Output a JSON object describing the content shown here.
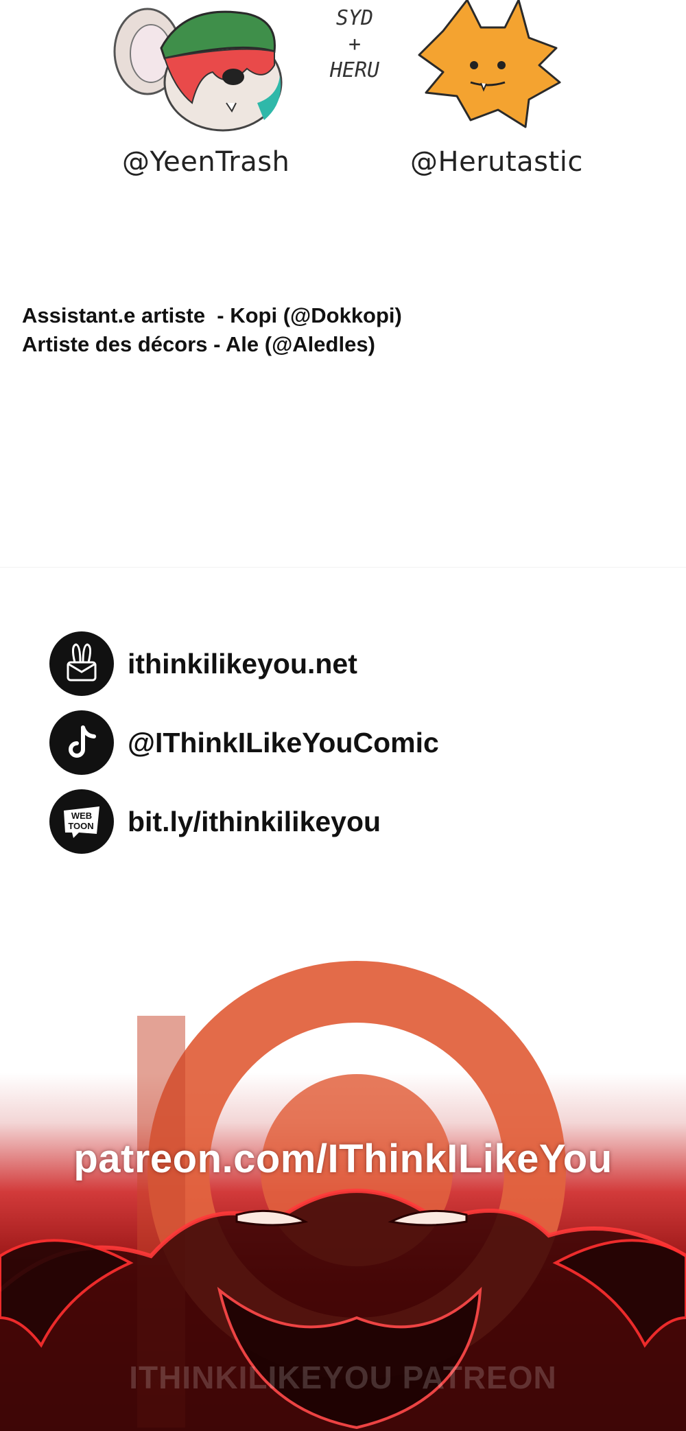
{
  "artists": {
    "left_handle": "@YeenTrash",
    "right_handle": "@Herutastic",
    "signature": [
      "SYD",
      "+",
      "HERU"
    ]
  },
  "credits": {
    "assistant": "Assistant.e artiste  - Kopi (@Dokkopi)",
    "backgrounds": "Artiste des décors - Ale (@Aledles)"
  },
  "links": [
    {
      "icon": "bunny-logo-icon",
      "text": "ithinkilikeyou.net"
    },
    {
      "icon": "tiktok-icon",
      "text": "@IThinkILikeYouComic"
    },
    {
      "icon": "webtoon-icon",
      "text": "bit.ly/ithinkilikeyou",
      "icon_label": "WEB TOON"
    }
  ],
  "patreon": {
    "url": "patreon.com/IThinkILikeYou",
    "watermark": "ITHINKILIKEYOU PATREON",
    "accent": "#e2633f"
  }
}
